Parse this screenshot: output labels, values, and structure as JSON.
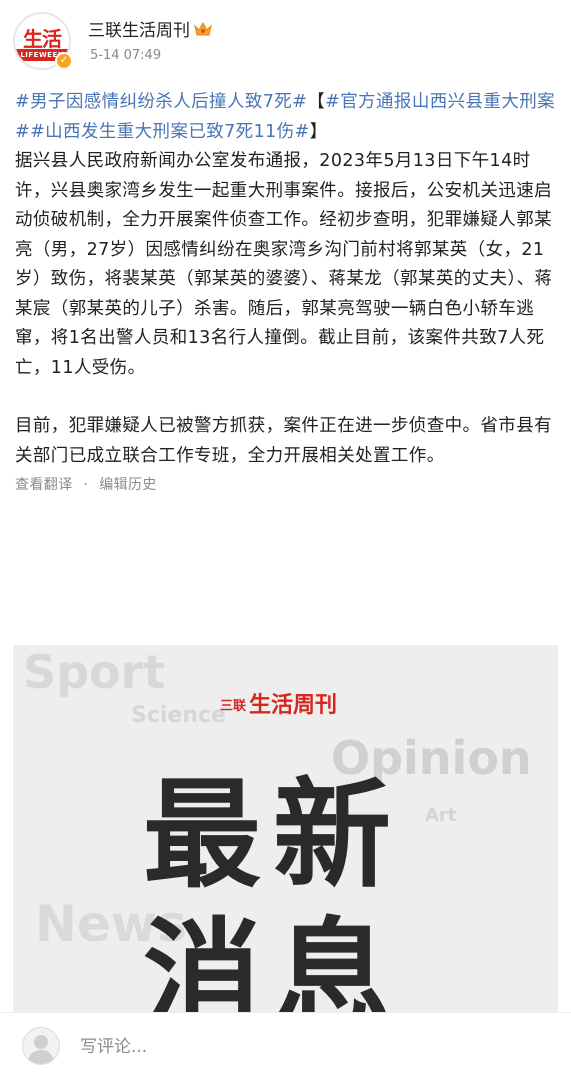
{
  "account": {
    "name": "三联生活周刊",
    "timestamp": "5-14 07:49",
    "avatar_logo": "生活",
    "avatar_band": "LIFEWEEK"
  },
  "post": {
    "hashtag_1": "#男子因感情纠纷杀人后撞人致7死#",
    "bracket_open": "【",
    "hashtag_2": "#官方通报山西兴县重大刑案#",
    "hashtag_3": "#山西发生重大刑案已致7死11伤#",
    "bracket_close": "】",
    "paragraph_1": "据兴县人民政府新闻办公室发布通报，2023年5月13日下午14时许，兴县奥家湾乡发生一起重大刑事案件。接报后，公安机关迅速启动侦破机制，全力开展案件侦查工作。经初步查明，犯罪嫌疑人郭某亮（男，27岁）因感情纠纷在奥家湾乡沟门前村将郭某英（女，21岁）致伤，将裴某英（郭某英的婆婆）、蒋某龙（郭某英的丈夫）、蒋某宸（郭某英的儿子）杀害。随后，郭某亮驾驶一辆白色小轿车逃窜，将1名出警人员和13名行人撞倒。截止目前，该案件共致7人死亡，11人受伤。",
    "paragraph_2": "目前，犯罪嫌疑人已被警方抓获，案件正在进一步侦查中。省市县有关部门已成立联合工作专班，全力开展相关处置工作。",
    "translate_label": "查看翻译",
    "separator": "·",
    "edit_history_label": "编辑历史"
  },
  "image": {
    "brand_mark": "三联",
    "brand_logo": "生活周刊",
    "title": "最新消息",
    "watermarks": [
      "Sport",
      "Science",
      "Opinion",
      "Art",
      "News"
    ]
  },
  "comment": {
    "placeholder": "写评论..."
  },
  "colors": {
    "hashtag": "#4a75b5",
    "brand_red": "#d7261e",
    "meta_gray": "#8a8a8a"
  }
}
